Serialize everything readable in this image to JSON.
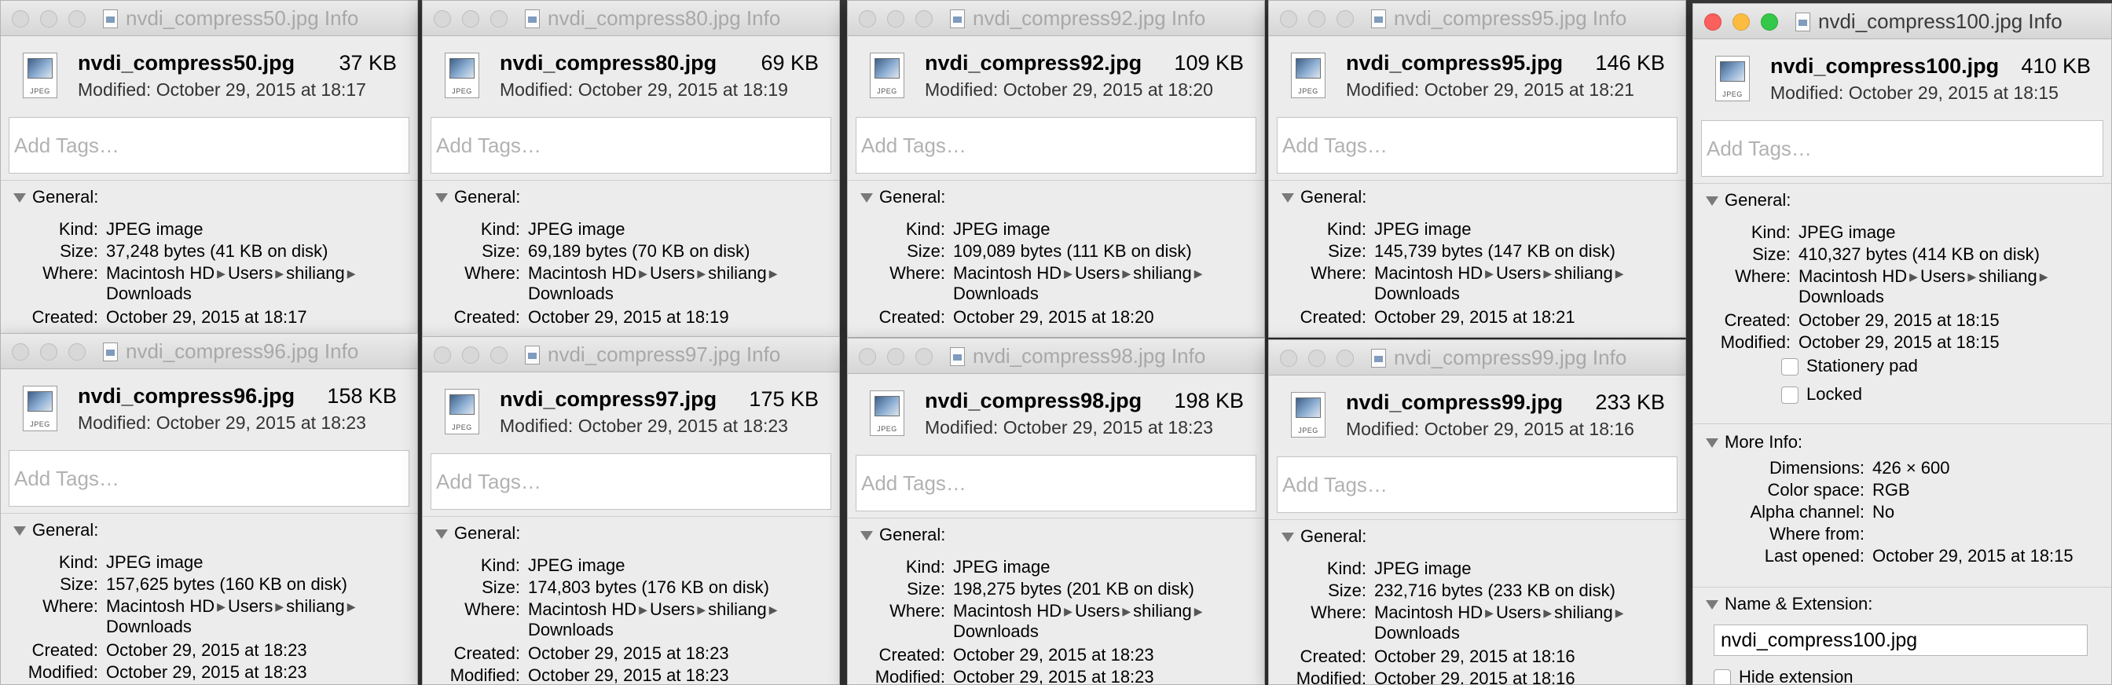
{
  "windows": [
    {
      "title": "nvdi_compress50.jpg Info",
      "name": "nvdi_compress50.jpg",
      "size": "37 KB",
      "modified": "Modified: October 29, 2015 at 18:17",
      "tags_placeholder": "Add Tags…",
      "general": "General:",
      "icon_ext": "JPEG",
      "kind_label": "Kind:",
      "kind": "JPEG image",
      "size_label": "Size:",
      "size_full": "37,248 bytes (41 KB on disk)",
      "where_label": "Where:",
      "where": [
        "Macintosh HD",
        "Users",
        "shiliang"
      ],
      "where2": "Downloads",
      "created_label": "Created:",
      "created": "October 29, 2015 at 18:17"
    },
    {
      "title": "nvdi_compress80.jpg Info",
      "name": "nvdi_compress80.jpg",
      "size": "69 KB",
      "modified": "Modified: October 29, 2015 at 18:19",
      "tags_placeholder": "Add Tags…",
      "general": "General:",
      "icon_ext": "JPEG",
      "kind_label": "Kind:",
      "kind": "JPEG image",
      "size_label": "Size:",
      "size_full": "69,189 bytes (70 KB on disk)",
      "where_label": "Where:",
      "where": [
        "Macintosh HD",
        "Users",
        "shiliang"
      ],
      "where2": "Downloads",
      "created_label": "Created:",
      "created": "October 29, 2015 at 18:19"
    },
    {
      "title": "nvdi_compress92.jpg Info",
      "name": "nvdi_compress92.jpg",
      "size": "109 KB",
      "modified": "Modified: October 29, 2015 at 18:20",
      "tags_placeholder": "Add Tags…",
      "general": "General:",
      "icon_ext": "JPEG",
      "kind_label": "Kind:",
      "kind": "JPEG image",
      "size_label": "Size:",
      "size_full": "109,089 bytes (111 KB on disk)",
      "where_label": "Where:",
      "where": [
        "Macintosh HD",
        "Users",
        "shiliang"
      ],
      "where2": "Downloads",
      "created_label": "Created:",
      "created": "October 29, 2015 at 18:20"
    },
    {
      "title": "nvdi_compress95.jpg Info",
      "name": "nvdi_compress95.jpg",
      "size": "146 KB",
      "modified": "Modified: October 29, 2015 at 18:21",
      "tags_placeholder": "Add Tags…",
      "general": "General:",
      "icon_ext": "JPEG",
      "kind_label": "Kind:",
      "kind": "JPEG image",
      "size_label": "Size:",
      "size_full": "145,739 bytes (147 KB on disk)",
      "where_label": "Where:",
      "where": [
        "Macintosh HD",
        "Users",
        "shiliang"
      ],
      "where2": "Downloads",
      "created_label": "Created:",
      "created": "October 29, 2015 at 18:21"
    },
    {
      "title": "nvdi_compress96.jpg Info",
      "name": "nvdi_compress96.jpg",
      "size": "158 KB",
      "modified": "Modified: October 29, 2015 at 18:23",
      "tags_placeholder": "Add Tags…",
      "general": "General:",
      "icon_ext": "JPEG",
      "kind_label": "Kind:",
      "kind": "JPEG image",
      "size_label": "Size:",
      "size_full": "157,625 bytes (160 KB on disk)",
      "where_label": "Where:",
      "where": [
        "Macintosh HD",
        "Users",
        "shiliang"
      ],
      "where2": "Downloads",
      "created_label": "Created:",
      "created": "October 29, 2015 at 18:23",
      "modified_label": "Modified:",
      "modified_full": "October 29, 2015 at 18:23"
    },
    {
      "title": "nvdi_compress97.jpg Info",
      "name": "nvdi_compress97.jpg",
      "size": "175 KB",
      "modified": "Modified: October 29, 2015 at 18:23",
      "tags_placeholder": "Add Tags…",
      "general": "General:",
      "icon_ext": "JPEG",
      "kind_label": "Kind:",
      "kind": "JPEG image",
      "size_label": "Size:",
      "size_full": "174,803 bytes (176 KB on disk)",
      "where_label": "Where:",
      "where": [
        "Macintosh HD",
        "Users",
        "shiliang"
      ],
      "where2": "Downloads",
      "created_label": "Created:",
      "created": "October 29, 2015 at 18:23",
      "modified_label": "Modified:",
      "modified_full": "October 29, 2015 at 18:23"
    },
    {
      "title": "nvdi_compress98.jpg Info",
      "name": "nvdi_compress98.jpg",
      "size": "198 KB",
      "modified": "Modified: October 29, 2015 at 18:23",
      "tags_placeholder": "Add Tags…",
      "general": "General:",
      "icon_ext": "JPEG",
      "kind_label": "Kind:",
      "kind": "JPEG image",
      "size_label": "Size:",
      "size_full": "198,275 bytes (201 KB on disk)",
      "where_label": "Where:",
      "where": [
        "Macintosh HD",
        "Users",
        "shiliang"
      ],
      "where2": "Downloads",
      "created_label": "Created:",
      "created": "October 29, 2015 at 18:23",
      "modified_label": "Modified:",
      "modified_full": "October 29, 2015 at 18:23"
    },
    {
      "title": "nvdi_compress99.jpg Info",
      "name": "nvdi_compress99.jpg",
      "size": "233 KB",
      "modified": "Modified: October 29, 2015 at 18:16",
      "tags_placeholder": "Add Tags…",
      "general": "General:",
      "icon_ext": "JPEG",
      "kind_label": "Kind:",
      "kind": "JPEG image",
      "size_label": "Size:",
      "size_full": "232,716 bytes (233 KB on disk)",
      "where_label": "Where:",
      "where": [
        "Macintosh HD",
        "Users",
        "shiliang"
      ],
      "where2": "Downloads",
      "created_label": "Created:",
      "created": "October 29, 2015 at 18:16",
      "modified_label": "Modified:",
      "modified_full": "October 29, 2015 at 18:16"
    },
    {
      "title": "nvdi_compress100.jpg Info",
      "name": "nvdi_compress100.jpg",
      "size": "410 KB",
      "modified": "Modified: October 29, 2015 at 18:15",
      "tags_placeholder": "Add Tags…",
      "general": "General:",
      "icon_ext": "JPEG",
      "kind_label": "Kind:",
      "kind": "JPEG image",
      "size_label": "Size:",
      "size_full": "410,327 bytes (414 KB on disk)",
      "where_label": "Where:",
      "where": [
        "Macintosh HD",
        "Users",
        "shiliang"
      ],
      "where2": "Downloads",
      "created_label": "Created:",
      "created": "October 29, 2015 at 18:15",
      "modified_label": "Modified:",
      "modified_full": "October 29, 2015 at 18:15",
      "stationery": "Stationery pad",
      "locked": "Locked",
      "more_info": "More Info:",
      "dimensions_label": "Dimensions:",
      "dimensions": "426 × 600",
      "color_label": "Color space:",
      "color": "RGB",
      "alpha_label": "Alpha channel:",
      "alpha": "No",
      "wherefrom_label": "Where from:",
      "wherefrom": "",
      "lastopened_label": "Last opened:",
      "lastopened": "October 29, 2015 at 18:15",
      "name_ext": "Name & Extension:",
      "name_value": "nvdi_compress100.jpg",
      "hide_ext": "Hide extension"
    }
  ]
}
